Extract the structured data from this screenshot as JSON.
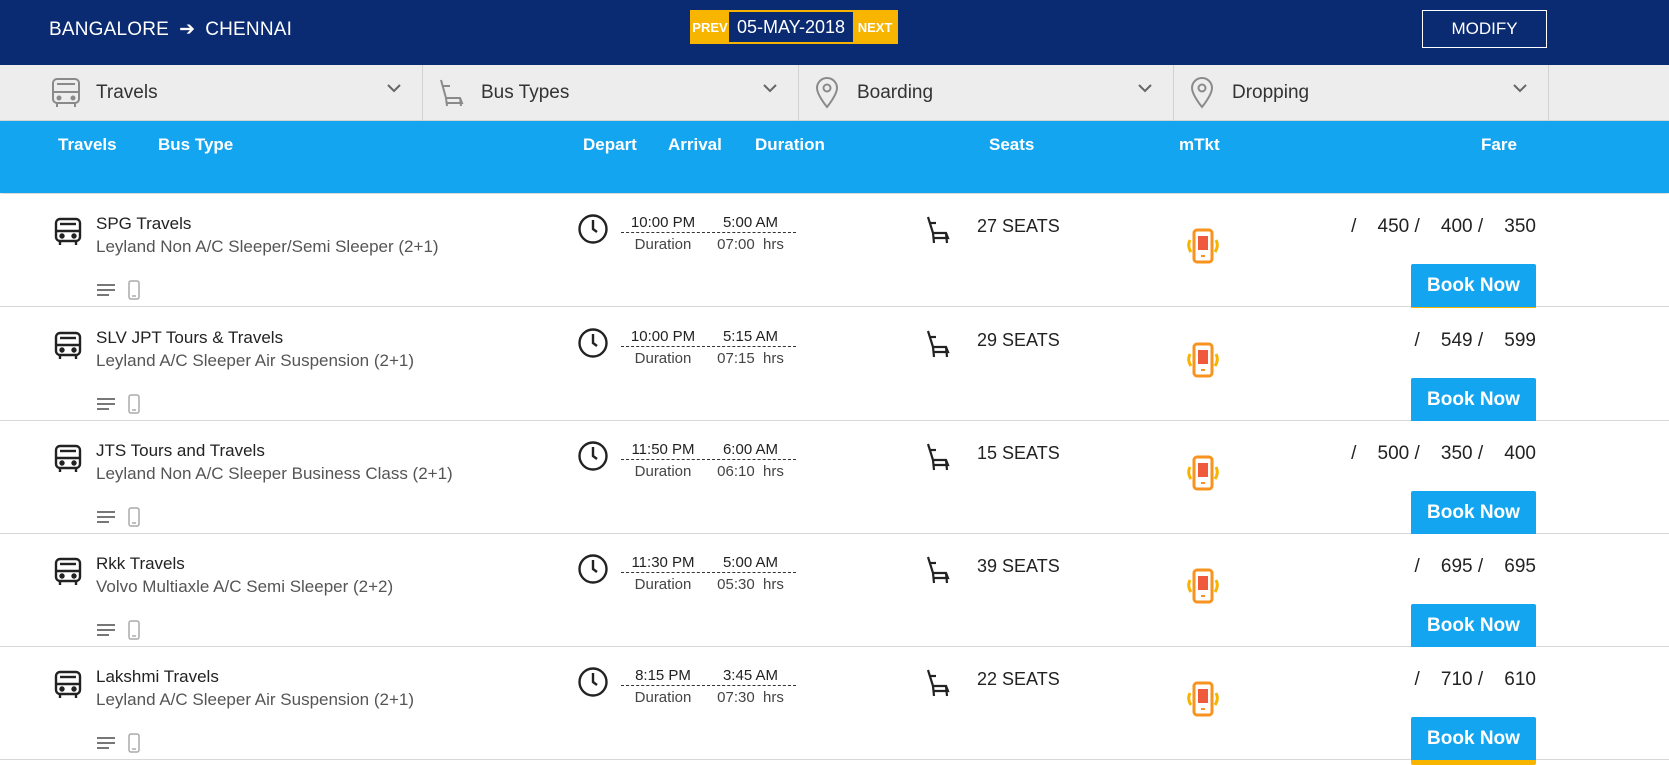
{
  "header": {
    "from": "BANGALORE",
    "arrow": "➔",
    "to": "CHENNAI",
    "prev_label": "PREV",
    "date": "05-MAY-2018",
    "next_label": "NEXT",
    "modify_label": "MODIFY"
  },
  "filters": [
    {
      "label": "Travels",
      "icon": "bus-icon"
    },
    {
      "label": "Bus Types",
      "icon": "seat-icon"
    },
    {
      "label": "Boarding",
      "icon": "location-pin-icon"
    },
    {
      "label": "Dropping",
      "icon": "location-pin-icon"
    }
  ],
  "columns": {
    "travels": "Travels",
    "bus_type": "Bus Type",
    "depart": "Depart",
    "arrival": "Arrival",
    "duration": "Duration",
    "seats": "Seats",
    "mtkt": "mTkt",
    "fare": "Fare"
  },
  "buses": [
    {
      "operator": "SPG Travels",
      "type": "Leyland Non A/C Sleeper/Semi Sleeper (2+1)",
      "depart": "10:00 PM",
      "arrival": "5:00 AM",
      "duration_label": "Duration",
      "duration": "07:00  hrs",
      "seats": "27 SEATS",
      "fare_text": "/    450 /    400 /    350",
      "book_label": "Book Now"
    },
    {
      "operator": "SLV JPT Tours & Travels",
      "type": "Leyland A/C Sleeper Air Suspension (2+1)",
      "depart": "10:00 PM",
      "arrival": "5:15 AM",
      "duration_label": "Duration",
      "duration": "07:15  hrs",
      "seats": "29 SEATS",
      "fare_text": "/    549 /    599",
      "book_label": "Book Now"
    },
    {
      "operator": "JTS Tours and Travels",
      "type": "Leyland Non A/C Sleeper Business Class (2+1)",
      "depart": "11:50 PM",
      "arrival": "6:00 AM",
      "duration_label": "Duration",
      "duration": "06:10  hrs",
      "seats": "15 SEATS",
      "fare_text": "/    500 /    350 /    400",
      "book_label": "Book Now"
    },
    {
      "operator": "Rkk Travels",
      "type": "Volvo Multiaxle A/C Semi Sleeper (2+2)",
      "depart": "11:30 PM",
      "arrival": "5:00 AM",
      "duration_label": "Duration",
      "duration": "05:30  hrs",
      "seats": "39 SEATS",
      "fare_text": "/    695 /    695",
      "book_label": "Book Now"
    },
    {
      "operator": "Lakshmi Travels",
      "type": "Leyland A/C Sleeper Air Suspension (2+1)",
      "depart": "8:15 PM",
      "arrival": "3:45 AM",
      "duration_label": "Duration",
      "duration": "07:30  hrs",
      "seats": "22 SEATS",
      "fare_text": "/    710 /    610",
      "book_label": "Book Now"
    }
  ],
  "colors": {
    "topbar": "#0a2a72",
    "accent": "#14a5f0",
    "yellow": "#f7b500",
    "mtkt": "#f7931e"
  }
}
